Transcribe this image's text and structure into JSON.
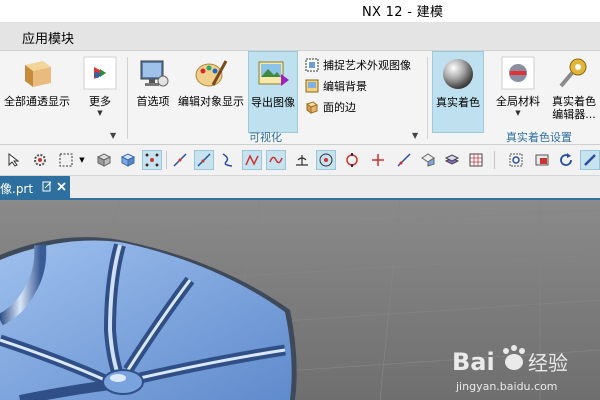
{
  "window": {
    "title": "NX 12 - 建模"
  },
  "menu_tab": {
    "label": "应用模块"
  },
  "ribbon": {
    "buttons": [
      {
        "label": "全部通透显示",
        "icon": "transparent-box-icon"
      },
      {
        "label": "更多",
        "icon": "more-shapes-icon"
      },
      {
        "label": "首选项",
        "icon": "preferences-monitor-icon"
      },
      {
        "label": "编辑对象显示",
        "icon": "palette-brush-icon"
      },
      {
        "label": "导出图像",
        "icon": "export-image-icon"
      },
      {
        "label": "真实着色",
        "icon": "shaded-sphere-icon"
      },
      {
        "label": "全局材料",
        "icon": "global-material-icon"
      },
      {
        "label": "真实着色\n编辑器...",
        "icon": "shading-editor-key-icon"
      }
    ],
    "small_items": [
      {
        "label": "捕捉艺术外观图像",
        "icon": "capture-image-icon"
      },
      {
        "label": "编辑背景",
        "icon": "edit-background-icon"
      },
      {
        "label": "面的边",
        "icon": "face-edges-icon"
      }
    ],
    "group_labels": {
      "visualize": "可视化",
      "true_shading_settings": "真实着色设置"
    }
  },
  "toolbar": {
    "icons": [
      "select-arrow-icon",
      "settings-gear-icon",
      "selection-box-icon",
      "dropdown-caret-icon",
      "solid-body-icon",
      "face-select-icon",
      "point-snap-icon",
      "line-icon",
      "curve-line-icon",
      "spline-icon",
      "mirror-curve-icon",
      "wave-curve-icon",
      "angle-icon",
      "circle-center-icon",
      "quadrant-point-icon",
      "intersection-icon",
      "pen-line-icon",
      "view-cube-icon",
      "layer-icon",
      "grid-icon",
      "zoom-fit-icon",
      "view-image-icon",
      "refresh-icon",
      "brush-icon"
    ]
  },
  "document": {
    "tab_name": "像.prt"
  },
  "watermark": {
    "brand": "Bai",
    "brand_suffix": "经验",
    "url": "jingyan.baidu.com"
  },
  "colors": {
    "accent": "#2d6f9e",
    "highlight": "#bfe1ef",
    "model_blue": "#7ea6dc",
    "viewport_bg": "#7c7c7c"
  }
}
